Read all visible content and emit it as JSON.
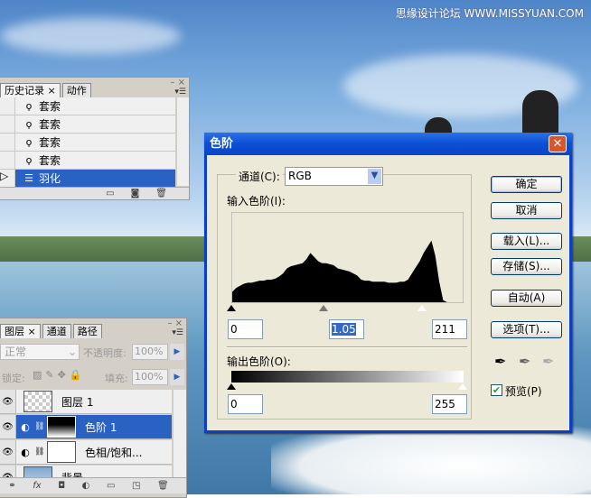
{
  "watermark": "思缘设计论坛 WWW.MISSYUAN.COM",
  "history_panel": {
    "tabs": [
      "历史记录",
      "动作"
    ],
    "items": [
      {
        "label": "套索",
        "icon": "lasso-icon"
      },
      {
        "label": "套索",
        "icon": "lasso-icon"
      },
      {
        "label": "套索",
        "icon": "lasso-icon"
      },
      {
        "label": "套索",
        "icon": "lasso-icon"
      },
      {
        "label": "羽化",
        "icon": "feather-icon",
        "selected": true
      }
    ]
  },
  "layers_panel": {
    "tabs": [
      "图层",
      "通道",
      "路径"
    ],
    "blend_mode": "正常",
    "opacity_label": "不透明度:",
    "opacity": "100%",
    "lock_label": "锁定:",
    "fill_label": "填充:",
    "fill": "100%",
    "layers": [
      {
        "name": "图层 1"
      },
      {
        "name": "色阶 1",
        "selected": true
      },
      {
        "name": "色相/饱和..."
      },
      {
        "name": "背景"
      }
    ]
  },
  "dialog": {
    "title": "色阶",
    "channel_label": "通道(C):",
    "channel": "RGB",
    "input_label": "输入色阶(I):",
    "input_black": "0",
    "input_gamma": "1.05",
    "input_white": "211",
    "output_label": "输出色阶(O):",
    "output_black": "0",
    "output_white": "255",
    "buttons": {
      "ok": "确定",
      "cancel": "取消",
      "load": "载入(L)...",
      "save": "存储(S)...",
      "auto": "自动(A)",
      "options": "选项(T)..."
    },
    "preview_label": "预览(P)",
    "preview_checked": true
  },
  "chart_data": {
    "type": "area",
    "title": "histogram",
    "xlim": [
      0,
      255
    ],
    "values": [
      10,
      14,
      16,
      18,
      19,
      19,
      20,
      21,
      21,
      22,
      22,
      23,
      25,
      28,
      33,
      35,
      36,
      37,
      38,
      42,
      48,
      44,
      40,
      38,
      38,
      37,
      36,
      33,
      32,
      31,
      30,
      28,
      26,
      22,
      21,
      21,
      20,
      20,
      20,
      20,
      19,
      19,
      19,
      20,
      20,
      22,
      28,
      34,
      40,
      48,
      54,
      60,
      45,
      20,
      2,
      0,
      0,
      0,
      0,
      0
    ]
  }
}
